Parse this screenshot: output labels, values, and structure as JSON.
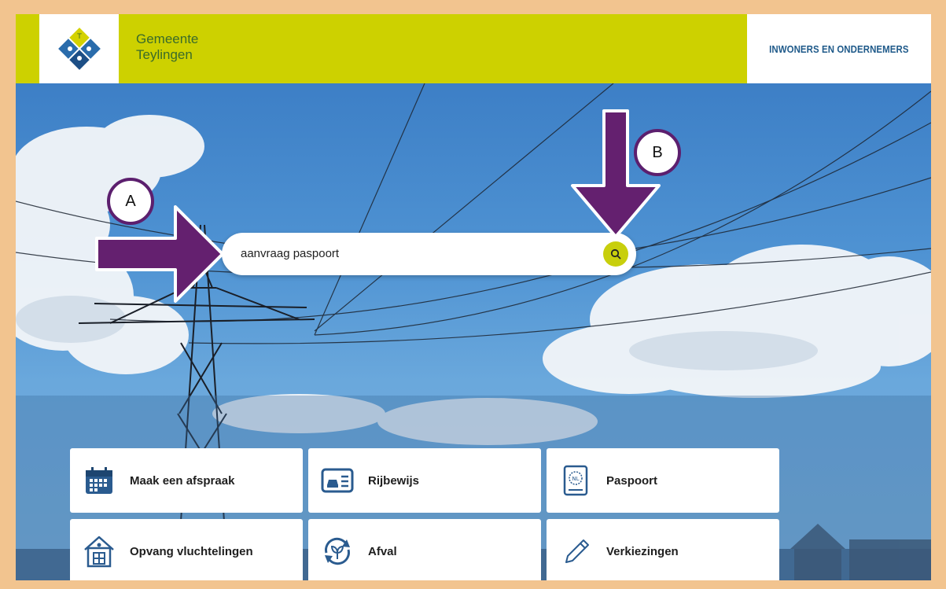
{
  "header": {
    "brand_line1": "Gemeente",
    "brand_line2": "Teylingen",
    "nav_label": "INWONERS EN ONDERNEMERS"
  },
  "search": {
    "value": "aanvraag paspoort",
    "button_icon": "search-icon"
  },
  "callouts": {
    "a": "A",
    "b": "B"
  },
  "tiles": [
    {
      "label": "Maak een afspraak",
      "icon": "calendar-icon"
    },
    {
      "label": "Rijbewijs",
      "icon": "driving-license-icon"
    },
    {
      "label": "Paspoort",
      "icon": "passport-icon"
    },
    {
      "label": "Opvang vluchtelingen",
      "icon": "house-icon"
    },
    {
      "label": "Afval",
      "icon": "recycle-icon"
    },
    {
      "label": "Verkiezingen",
      "icon": "pencil-icon"
    }
  ],
  "colors": {
    "brand_lime": "#cdd100",
    "nav_blue": "#1f5a8a",
    "callout_purple": "#5c1f6e",
    "frame_tan": "#f2c48f"
  }
}
